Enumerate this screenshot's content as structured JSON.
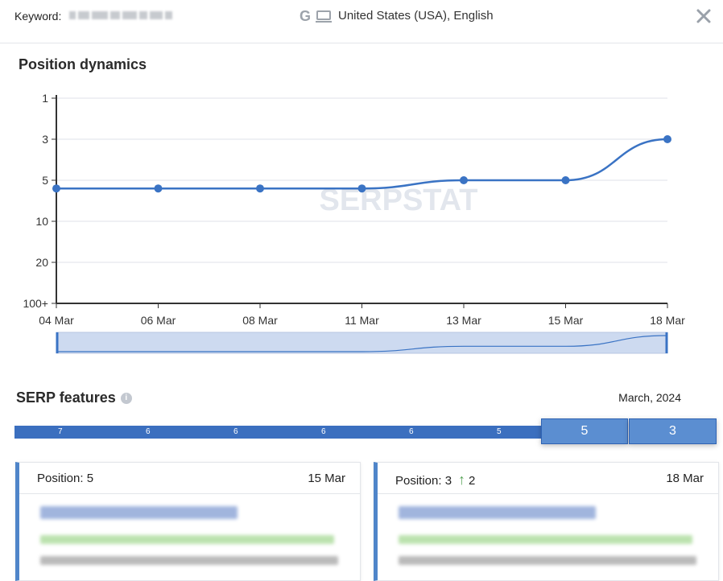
{
  "header": {
    "keyword_label": "Keyword:",
    "engine_letter": "G",
    "region": "United States (USA), English",
    "close_icon": "close-icon"
  },
  "position_dynamics": {
    "title": "Position dynamics",
    "watermark": "SERPSTAT"
  },
  "chart_data": {
    "type": "line",
    "title": "Position dynamics",
    "xlabel": "",
    "ylabel": "",
    "y_tick_labels": [
      "1",
      "3",
      "5",
      "10",
      "20",
      "100+"
    ],
    "y_inverted": true,
    "x": [
      "04 Mar",
      "06 Mar",
      "08 Mar",
      "11 Mar",
      "13 Mar",
      "15 Mar",
      "18 Mar"
    ],
    "series": [
      {
        "values": [
          6,
          6,
          6,
          6,
          5,
          5,
          3
        ],
        "color": "#3a73c4"
      }
    ],
    "grid": true,
    "line_color": "#3a73c4"
  },
  "serp_features": {
    "title": "SERP features",
    "month": "March, 2024",
    "timeline_values": [
      "7",
      "6",
      "6",
      "6",
      "6",
      "5"
    ],
    "selected": [
      "5",
      "3"
    ]
  },
  "cards": [
    {
      "position_label": "Position: 5",
      "change": "",
      "date": "15 Mar"
    },
    {
      "position_label": "Position: 3",
      "change": "2",
      "date": "18 Mar"
    }
  ]
}
